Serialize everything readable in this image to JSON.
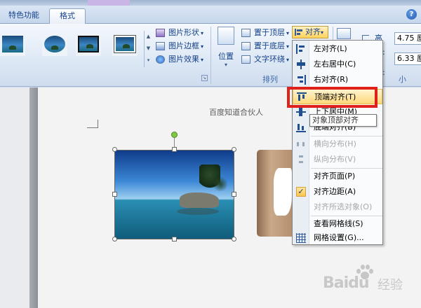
{
  "tabs": [
    "特色功能",
    "格式"
  ],
  "help_icon": "?",
  "ribbon": {
    "picture_commands": [
      {
        "label": "图片形状",
        "icon": "shape-icon"
      },
      {
        "label": "图片边框",
        "icon": "pen-border-icon"
      },
      {
        "label": "图片效果",
        "icon": "effects-icon"
      }
    ],
    "position_label": "位置",
    "arrange_commands": [
      {
        "label": "置于顶层",
        "icon": "bring-front-icon"
      },
      {
        "label": "置于底层",
        "icon": "send-back-icon"
      },
      {
        "label": "文字环绕",
        "icon": "wrap-text-icon"
      }
    ],
    "align_label": "对齐",
    "arrange_group_label": "排列",
    "size_group_label": "小",
    "height_label": "高度:",
    "height_value": "4.75 厘",
    "width_label": "宽度:",
    "width_value": "6.33 厘"
  },
  "document": {
    "header_text": "百度知道合伙人"
  },
  "menu": {
    "items": [
      {
        "label": "左对齐(L)",
        "icon": "align-left-icon",
        "enabled": true
      },
      {
        "label": "左右居中(C)",
        "icon": "align-center-icon",
        "enabled": true
      },
      {
        "label": "右对齐(R)",
        "icon": "align-right-icon",
        "enabled": true
      },
      {
        "label": "顶端对齐(T)",
        "icon": "align-top-icon",
        "enabled": true,
        "highlighted": true
      },
      {
        "label": "上下居中(M)",
        "icon": "align-middle-icon",
        "enabled": true
      },
      {
        "label": "底端对齐(B)",
        "icon": "align-bottom-icon",
        "enabled": true
      },
      {
        "label": "横向分布(H)",
        "icon": "distribute-horizontal-icon",
        "enabled": false
      },
      {
        "label": "纵向分布(V)",
        "icon": "distribute-vertical-icon",
        "enabled": false
      },
      {
        "label": "对齐页面(P)",
        "icon": "",
        "enabled": true
      },
      {
        "label": "对齐边距(A)",
        "icon": "checkmark-icon",
        "enabled": true,
        "checked": true
      },
      {
        "label": "对齐所选对象(O)",
        "icon": "",
        "enabled": false
      },
      {
        "label": "查看网格线(S)",
        "icon": "",
        "enabled": true
      },
      {
        "label": "网格设置(G)...",
        "icon": "grid-icon",
        "enabled": true
      }
    ],
    "check_glyph": "✓"
  },
  "tooltip": "对象顶部对齐",
  "watermark": {
    "brand": "Baidu",
    "suffix": "经验"
  },
  "colors": {
    "highlight_box": "#e0201a",
    "menu_highlight": "#ffd87a",
    "rotate_handle": "#7ec843"
  }
}
